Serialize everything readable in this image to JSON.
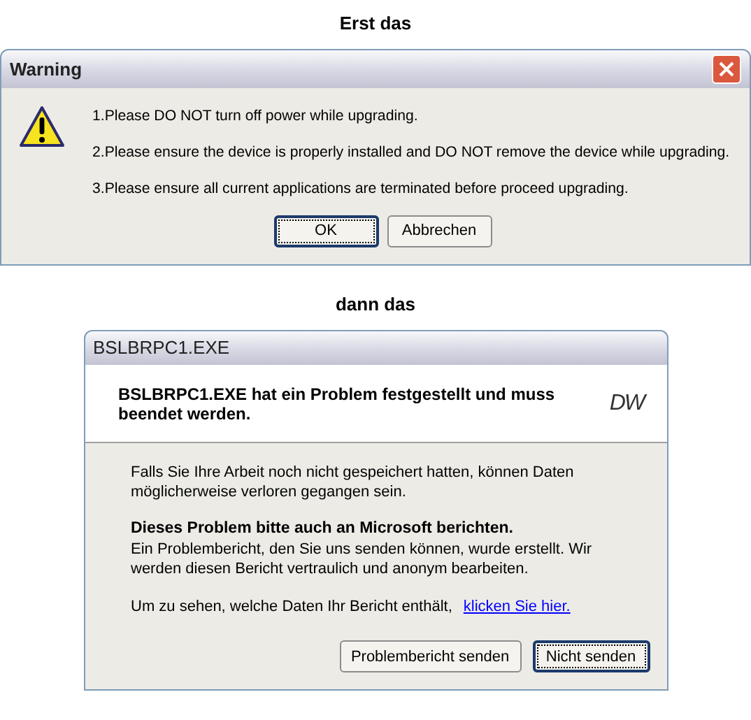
{
  "caption_1": "Erst das",
  "warning_window": {
    "title": "Warning",
    "messages": [
      "1.Please DO NOT turn off power while upgrading.",
      "2.Please ensure the device is properly installed and DO NOT remove the device while upgrading.",
      "3.Please ensure all current applications are terminated before proceed upgrading."
    ],
    "buttons": [
      {
        "label": "OK",
        "default": true
      },
      {
        "label": "Abbrechen",
        "default": false
      }
    ]
  },
  "caption_2": "dann das",
  "error_window": {
    "title": "BSLBRPC1.EXE",
    "heading": "BSLBRPC1.EXE hat ein Problem festgestellt und muss beendet werden.",
    "logo": "DW",
    "text_1": "Falls Sie Ihre Arbeit noch nicht gespeichert hatten, können Daten möglicherweise verloren gegangen sein.",
    "subheading": "Dieses Problem bitte auch an Microsoft berichten.",
    "text_2": "Ein Problembericht, den Sie uns senden können, wurde erstellt. Wir werden diesen Bericht vertraulich und anonym bearbeiten.",
    "link_prompt": "Um zu sehen, welche Daten Ihr Bericht enthält,",
    "link": "klicken Sie hier.",
    "buttons": [
      {
        "label": "Problembericht senden",
        "default": false
      },
      {
        "label": "Nicht senden",
        "default": true
      }
    ]
  }
}
